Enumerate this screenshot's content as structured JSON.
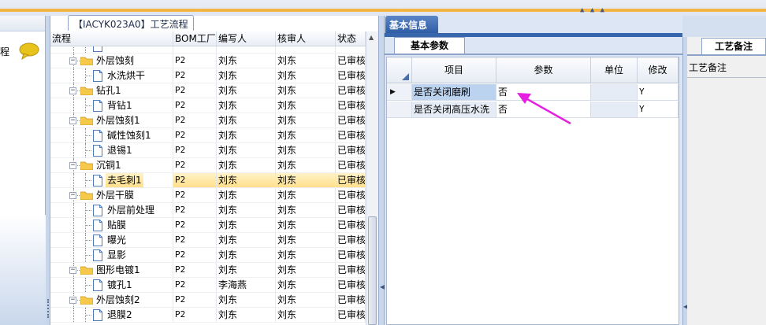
{
  "tree_tab": {
    "title": "【IACYK023A0】工艺流程"
  },
  "left_panel": {
    "item_label": "程"
  },
  "tree": {
    "headers": [
      "流程",
      "BOM工厂",
      "编写人",
      "核审人",
      "状态"
    ],
    "rows": [
      {
        "level": 1,
        "type": "doc",
        "name": "",
        "bom": "",
        "writer": "",
        "reviewer": "",
        "status": ""
      },
      {
        "level": 0,
        "type": "folder",
        "name": "外层蚀刻",
        "bom": "P2",
        "writer": "刘东",
        "reviewer": "刘东",
        "status": "已审核"
      },
      {
        "level": 1,
        "type": "doc",
        "name": "水洗烘干",
        "bom": "P2",
        "writer": "刘东",
        "reviewer": "刘东",
        "status": "已审核"
      },
      {
        "level": 0,
        "type": "folder",
        "name": "钻孔1",
        "bom": "P2",
        "writer": "刘东",
        "reviewer": "刘东",
        "status": "已审核"
      },
      {
        "level": 1,
        "type": "doc",
        "name": "背钻1",
        "bom": "P2",
        "writer": "刘东",
        "reviewer": "刘东",
        "status": "已审核"
      },
      {
        "level": 0,
        "type": "folder",
        "name": "外层蚀刻1",
        "bom": "P2",
        "writer": "刘东",
        "reviewer": "刘东",
        "status": "已审核"
      },
      {
        "level": 1,
        "type": "doc",
        "name": "碱性蚀刻1",
        "bom": "P2",
        "writer": "刘东",
        "reviewer": "刘东",
        "status": "已审核"
      },
      {
        "level": 1,
        "type": "doc",
        "name": "退锡1",
        "bom": "P2",
        "writer": "刘东",
        "reviewer": "刘东",
        "status": "已审核"
      },
      {
        "level": 0,
        "type": "folder",
        "name": "沉铜1",
        "bom": "P2",
        "writer": "刘东",
        "reviewer": "刘东",
        "status": "已审核"
      },
      {
        "level": 1,
        "type": "doc",
        "name": "去毛刺1",
        "bom": "P2",
        "writer": "刘东",
        "reviewer": "刘东",
        "status": "已审核",
        "selected": true
      },
      {
        "level": 0,
        "type": "folder",
        "name": "外层干膜",
        "bom": "P2",
        "writer": "刘东",
        "reviewer": "刘东",
        "status": "已审核"
      },
      {
        "level": 1,
        "type": "doc",
        "name": "外层前处理",
        "bom": "P2",
        "writer": "刘东",
        "reviewer": "刘东",
        "status": "已审核"
      },
      {
        "level": 1,
        "type": "doc",
        "name": "贴膜",
        "bom": "P2",
        "writer": "刘东",
        "reviewer": "刘东",
        "status": "已审核"
      },
      {
        "level": 1,
        "type": "doc",
        "name": "曝光",
        "bom": "P2",
        "writer": "刘东",
        "reviewer": "刘东",
        "status": "已审核"
      },
      {
        "level": 1,
        "type": "doc",
        "name": "显影",
        "bom": "P2",
        "writer": "刘东",
        "reviewer": "刘东",
        "status": "已审核"
      },
      {
        "level": 0,
        "type": "folder",
        "name": "图形电镀1",
        "bom": "P2",
        "writer": "刘东",
        "reviewer": "刘东",
        "status": "已审核"
      },
      {
        "level": 1,
        "type": "doc",
        "name": "镀孔1",
        "bom": "P2",
        "writer": "李海燕",
        "reviewer": "刘东",
        "status": "已审核"
      },
      {
        "level": 0,
        "type": "folder",
        "name": "外层蚀刻2",
        "bom": "P2",
        "writer": "刘东",
        "reviewer": "刘东",
        "status": "已审核"
      },
      {
        "level": 1,
        "type": "doc",
        "name": "退膜2",
        "bom": "P2",
        "writer": "刘东",
        "reviewer": "刘东",
        "status": "已审核"
      }
    ]
  },
  "info": {
    "tab_title": "基本信息",
    "sub_tab": "基本参数",
    "headers": {
      "item": "项目",
      "param": "参数",
      "unit": "单位",
      "modify": "修改"
    },
    "rows": [
      {
        "item": "是否关闭磨刷",
        "param": "否",
        "unit": "",
        "modify": "Y",
        "active": true,
        "pointer": "▶"
      },
      {
        "item": "是否关闭高压水洗",
        "param": "否",
        "unit": "",
        "modify": "Y",
        "active": false,
        "pointer": ""
      }
    ]
  },
  "remark": {
    "tab_title": "工艺备注",
    "label": "工艺备注"
  },
  "colors": {
    "accent": "#3866ad",
    "selection": "#ffdf8a",
    "annotation": "#e620e0",
    "topbar_orange": "#f3b645"
  }
}
